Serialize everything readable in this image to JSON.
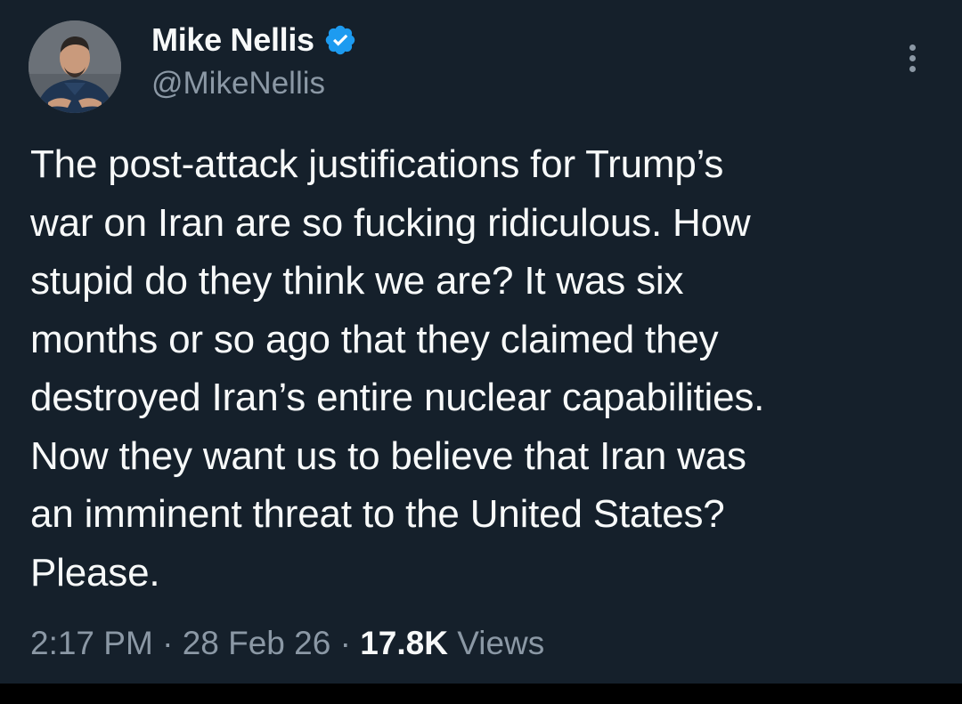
{
  "author": {
    "display_name": "Mike Nellis",
    "handle": "@MikeNellis",
    "verified": true
  },
  "tweet": {
    "lines": [
      "The post-attack justifications for Trump’s",
      "war on Iran are so fucking ridiculous. How",
      "stupid do they think we are? It was six",
      "months or so ago that they claimed they",
      "destroyed Iran’s entire nuclear capabilities.",
      "Now they want us to believe that Iran was",
      "an imminent threat to the United States?",
      "Please."
    ]
  },
  "meta": {
    "time": "2:17 PM",
    "separator": "·",
    "date": "28 Feb 26",
    "views_count": "17.8K",
    "views_label": "Views"
  },
  "colors": {
    "background": "#15202b",
    "text_primary": "#f7f9f9",
    "text_secondary": "#8b98a5",
    "verified_badge": "#1d9bf0"
  },
  "icons": {
    "verified": "verified-badge-icon",
    "more": "more-options-icon"
  }
}
